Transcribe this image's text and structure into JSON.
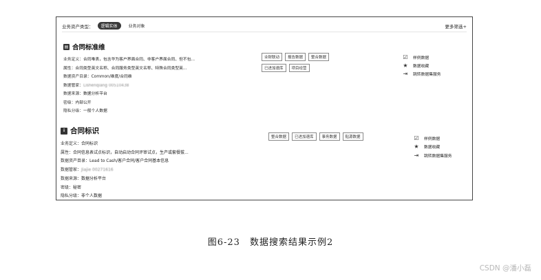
{
  "filter": {
    "label": "业务资产类型：",
    "chips": [
      "逻辑实体",
      "业务对象"
    ],
    "more": "更多筛选+"
  },
  "cards": [
    {
      "title": "合同标准维",
      "meta": [
        {
          "k": "业务定义：",
          "v": "合同唯表，包含华为客户界面合同、非客户界面合同、但不包..."
        },
        {
          "k": "属性：",
          "v": "合同类型英文名称、合同服务类型英文名称、特殊合同类型英..."
        },
        {
          "k": "数据资产目录：",
          "v": "Common/维度/合同维"
        },
        {
          "k": "数据管家：",
          "v": "Lishenqiang 00510438"
        },
        {
          "k": "数据来源：",
          "v": "数据分析平台"
        },
        {
          "k": "密级：",
          "v": "内部公开"
        },
        {
          "k": "隐私分级：",
          "v": "一般个人数据"
        }
      ],
      "tags": [
        "业财联动",
        "报告数据",
        "整合数据",
        "已进加速库",
        "项目经营"
      ],
      "actions": [
        {
          "icon": "sample-icon",
          "label": "样例数据"
        },
        {
          "icon": "star-icon",
          "label": "数据收藏"
        },
        {
          "icon": "jump-icon",
          "label": "跳转数据集服务"
        }
      ]
    },
    {
      "title": "合同标识",
      "meta": [
        {
          "k": "业务定义：",
          "v": "合同标识"
        },
        {
          "k": "属性：",
          "v": "合同信息表试点标识，自动启动合同评审试点，生产或套餐拔..."
        },
        {
          "k": "数据资产目录：",
          "v": "Lead to Cash/客户合同/客户合同基本信息"
        },
        {
          "k": "数据管家：",
          "v": "Jiajie 00271616"
        },
        {
          "k": "数据来源：",
          "v": "数据分析平台"
        },
        {
          "k": "密级：",
          "v": "秘密"
        },
        {
          "k": "隐私分级：",
          "v": "非个人数据"
        }
      ],
      "tags": [
        "整合数据",
        "已进加速库",
        "事务数据",
        "贴源数据"
      ],
      "actions": [
        {
          "icon": "sample-icon",
          "label": "样例数据"
        },
        {
          "icon": "star-icon",
          "label": "数据收藏"
        },
        {
          "icon": "jump-icon",
          "label": "跳转数据集服务"
        }
      ]
    }
  ],
  "caption": "图6-23　数据搜索结果示例2",
  "watermark": "CSDN @潘小磊"
}
